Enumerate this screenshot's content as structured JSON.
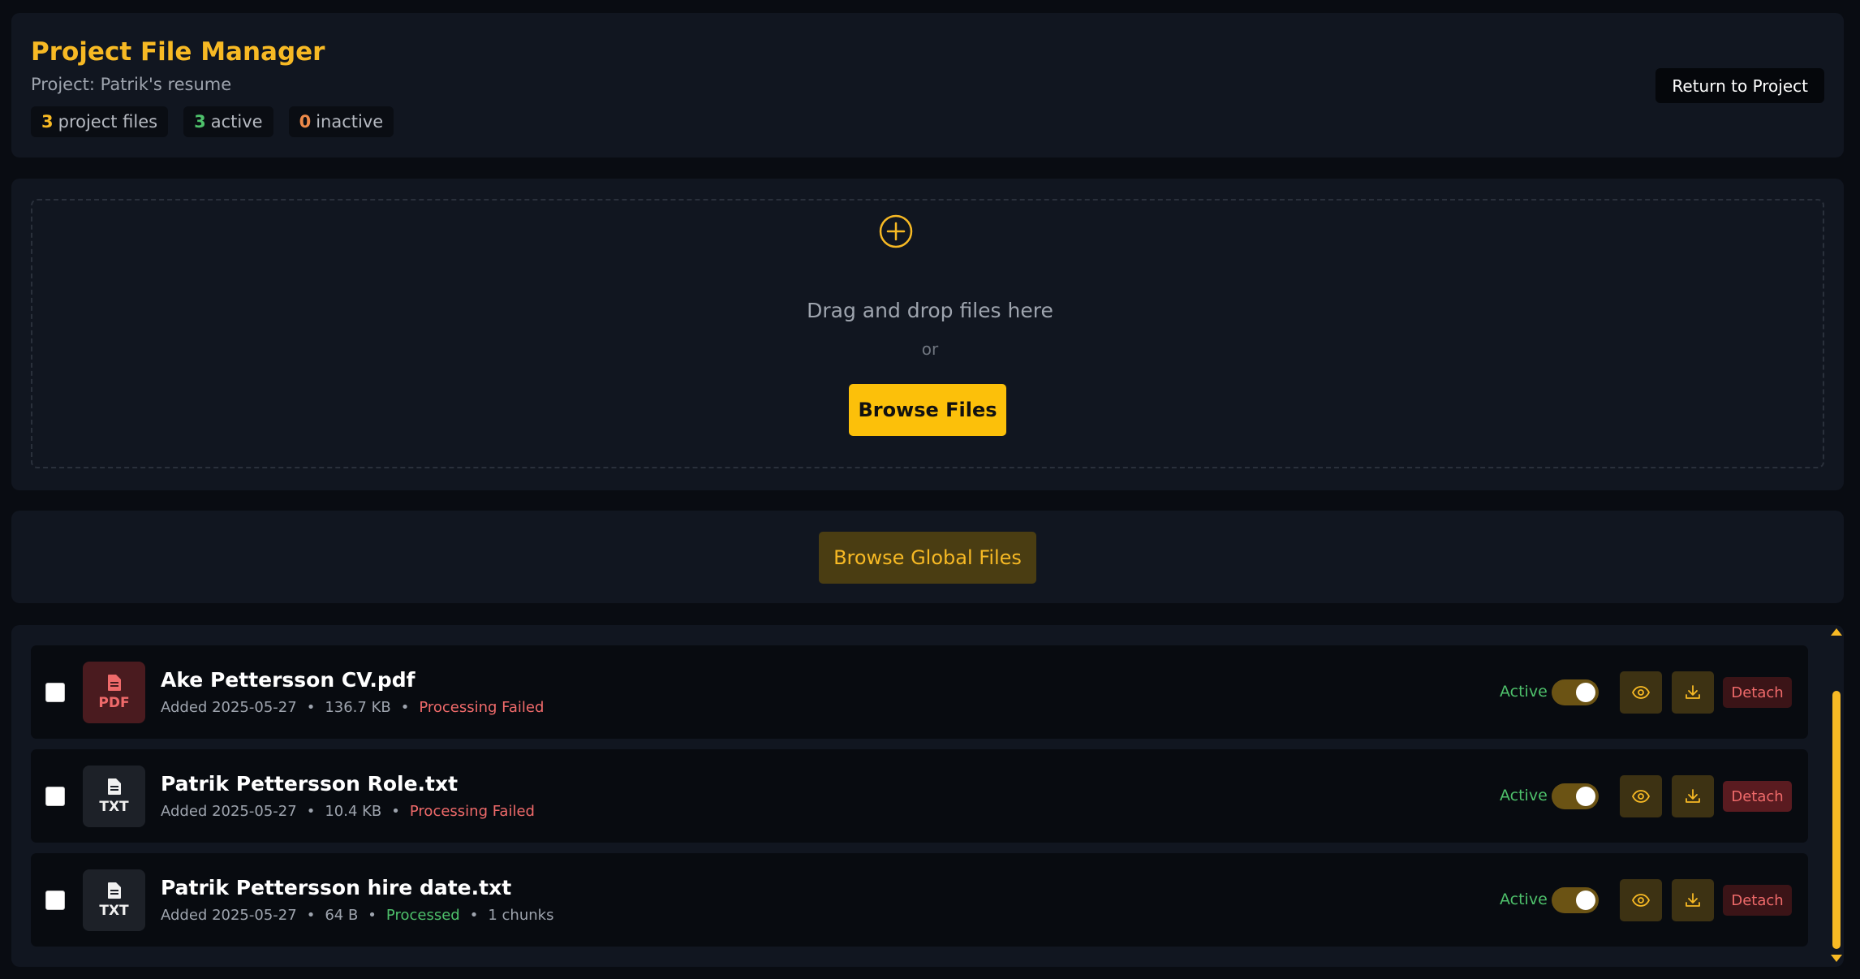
{
  "header": {
    "title": "Project File Manager",
    "subtitle": "Project: Patrik's resume",
    "badges": [
      {
        "count": "3",
        "label": "project files"
      },
      {
        "count": "3",
        "label": "active"
      },
      {
        "count": "0",
        "label": "inactive"
      }
    ],
    "return_label": "Return to Project"
  },
  "upload": {
    "icon": "plus-circle-icon",
    "drag_text": "Drag and drop files here",
    "or_text": "or",
    "browse_label": "Browse Files"
  },
  "global": {
    "browse_label": "Browse Global Files"
  },
  "files": [
    {
      "type": "PDF",
      "name": "Ake Pettersson CV.pdf",
      "added": "Added 2025-05-27",
      "size": "136.7 KB",
      "status": "Processing Failed",
      "chunks": "",
      "active_label": "Active",
      "active": true,
      "detach_label": "Detach"
    },
    {
      "type": "TXT",
      "name": "Patrik Pettersson Role.txt",
      "added": "Added 2025-05-27",
      "size": "10.4 KB",
      "status": "Processing Failed",
      "chunks": "",
      "active_label": "Active",
      "active": true,
      "detach_label": "Detach"
    },
    {
      "type": "TXT",
      "name": "Patrik Pettersson hire date.txt",
      "added": "Added 2025-05-27",
      "size": "64 B",
      "status": "Processed",
      "chunks": "1 chunks",
      "active_label": "Active",
      "active": true,
      "detach_label": "Detach"
    }
  ],
  "colors": {
    "accent": "#f7b924",
    "success": "#4ec16b",
    "danger": "#ef6a6a",
    "warning": "#ee8a4a",
    "background": "#090c12",
    "panel": "#111620"
  }
}
